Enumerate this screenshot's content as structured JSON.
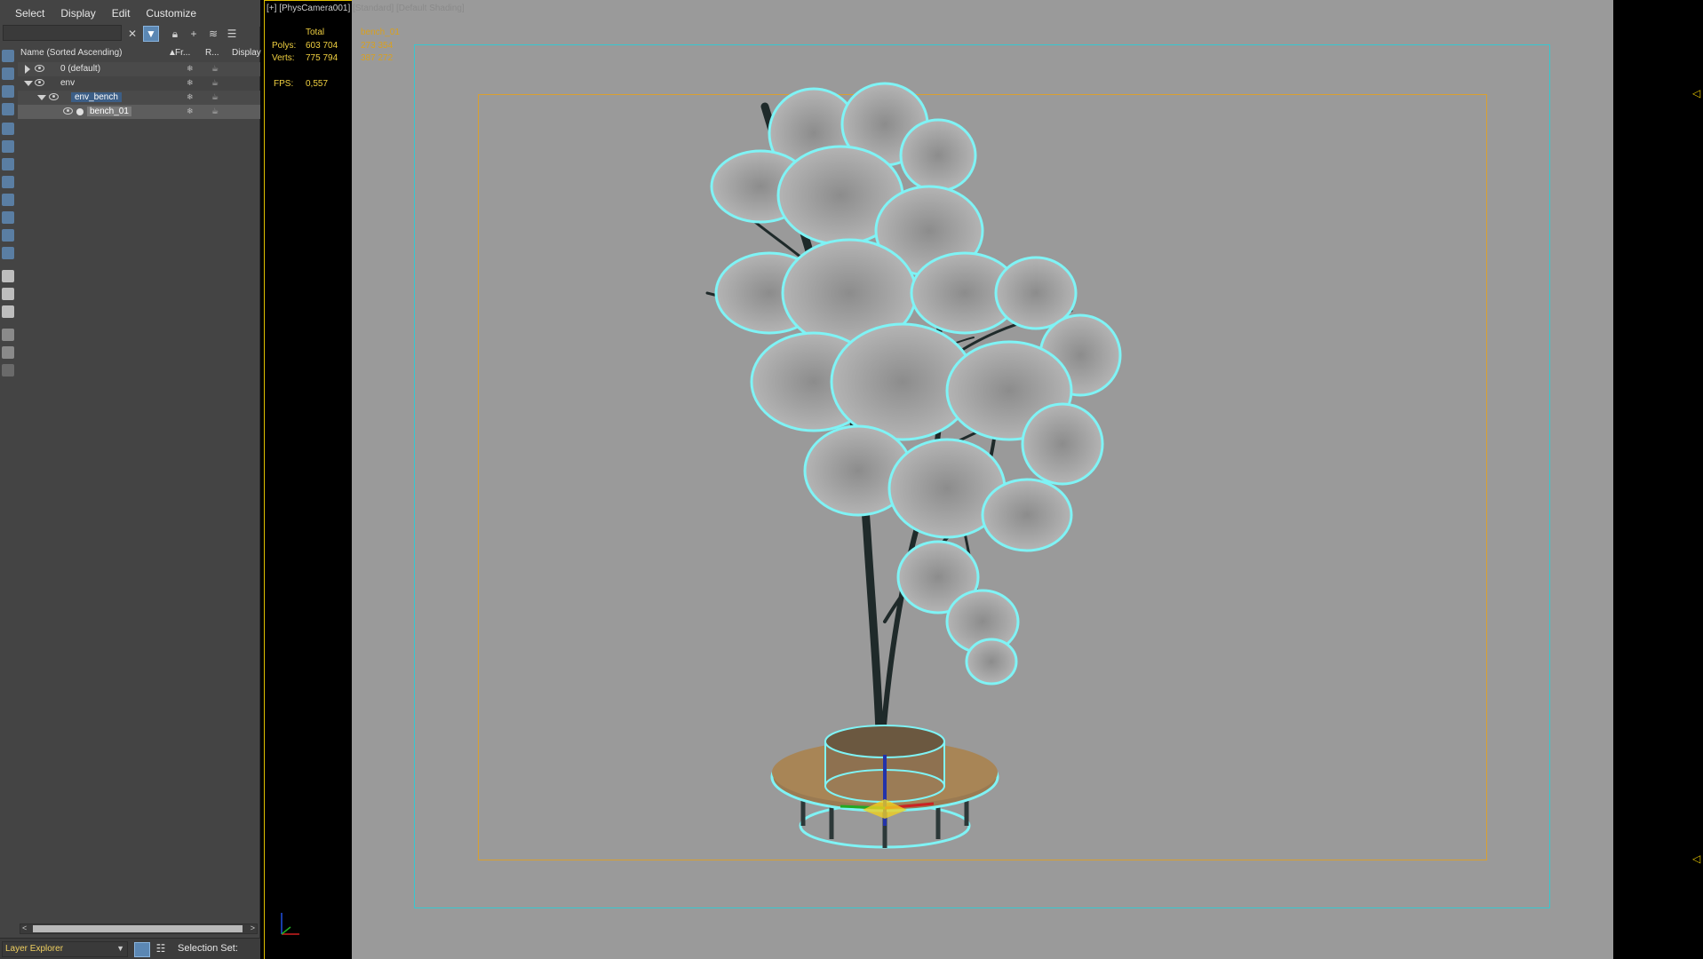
{
  "menu": [
    "Select",
    "Display",
    "Edit",
    "Customize"
  ],
  "explorer": {
    "header": {
      "name": "Name (Sorted Ascending)",
      "sort": "▲",
      "col_freeze": "Fr...",
      "col_render": "R...",
      "col_display": "Display"
    },
    "rows": [
      {
        "label": "0 (default)"
      },
      {
        "label": "env"
      },
      {
        "label": "env_bench"
      },
      {
        "label": "bench_01"
      }
    ],
    "scroll_left": "<",
    "scroll_right": ">"
  },
  "bottom_bar": {
    "explorer_select": "Layer Explorer",
    "selection_set_label": "Selection Set:"
  },
  "viewport": {
    "label_bracket": "[+]",
    "label_camera": "[PhysCamera001]",
    "label_standard": "[Standard]",
    "label_shading": "[Default Shading]"
  },
  "stats": {
    "total_label": "Total",
    "object_label": "bench_01",
    "polys_label": "Polys:",
    "polys_total": "603 704",
    "polys_object": "273 354",
    "verts_label": "Verts:",
    "verts_total": "775 794",
    "verts_object": "387 272",
    "fps_label": "FPS:",
    "fps_value": "0,557"
  },
  "colors": {
    "panel": "#444444",
    "viewport_bg": "#9a9a9a",
    "safe_frame": "#36c8d0",
    "action_frame": "#d9a030",
    "stats_text": "#f0d040",
    "selection_outline": "#7ff3f5",
    "accent": "#5b87b3"
  }
}
